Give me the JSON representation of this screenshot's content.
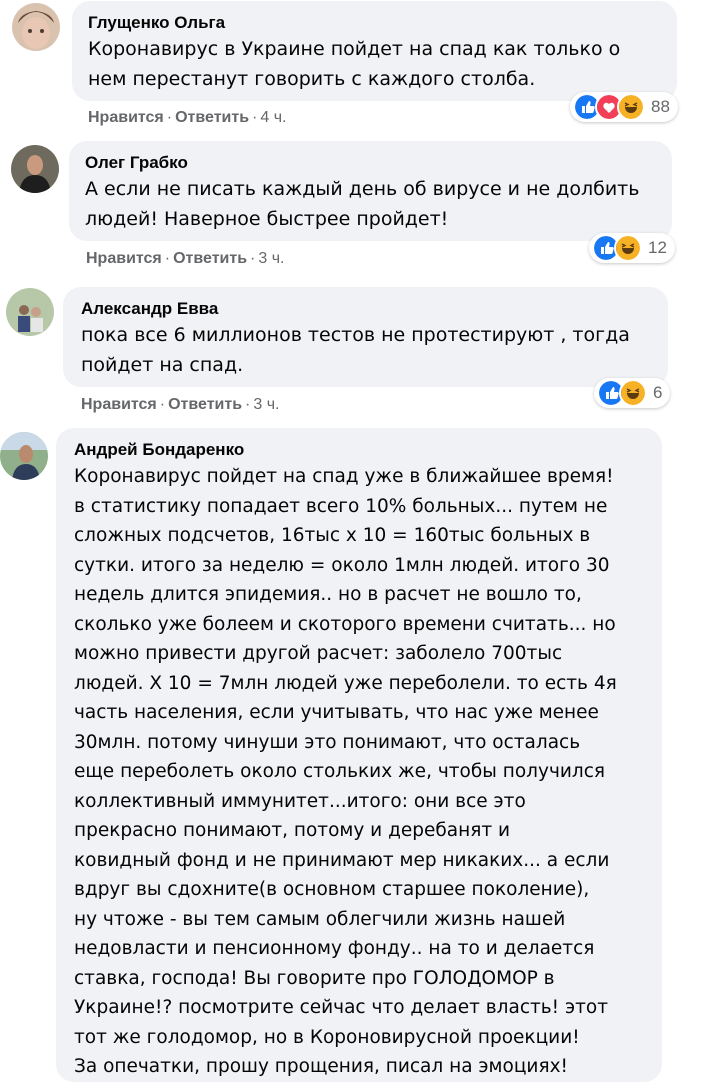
{
  "actions": {
    "like": "Нравится",
    "reply": "Ответить",
    "dot": "·"
  },
  "colors": {
    "bubble": "#f0f2f5",
    "meta": "#65676b",
    "like_blue": "#1877f2",
    "love_red": "#f33e58",
    "haha_yellow": "#f7b125"
  },
  "comments": [
    {
      "author": "Глущенко Ольга",
      "text": "Коронавирус в Украине пойдет на спад как только о\nнем перестанут говорить с каждого столба.",
      "time": "4 ч.",
      "reactions": [
        "like-icon",
        "love-icon",
        "haha-icon"
      ],
      "reaction_count": "88"
    },
    {
      "author": "Олег Грабко",
      "text": "А если не писать каждый день об вирусе и не долбить\nлюдей! Наверное быстрее пройдет!",
      "time": "3 ч.",
      "reactions": [
        "like-icon",
        "haha-icon"
      ],
      "reaction_count": "12"
    },
    {
      "author": "Александр Евва",
      "text": "пока все 6 миллионов тестов не протестируют , тогда\nпойдет на спад.",
      "time": "3 ч.",
      "reactions": [
        "like-icon",
        "haha-icon"
      ],
      "reaction_count": "6"
    },
    {
      "author": "Андрей Бондаренко",
      "text": "Коронавирус пойдет на спад уже в ближайшее время!\nв статистику попадает всего 10% больных... путем не\nсложных подсчетов, 16тыс х 10 = 160тыс больных в\nсутки. итого за неделю = около 1млн людей. итого 30\nнедель длится эпидемия.. но в расчет не вошло то,\nсколько уже болеем и скоторого времени считать... но\nможно привести другой расчет: заболело 700тыс\nлюдей. Х 10 = 7млн людей уже переболели. то есть 4я\nчасть населения, если учитывать, что нас уже менее\n30млн. потому чинуши это понимают, что осталась\nеще переболеть около стольких же, чтобы получился\nколлективный иммунитет...итого: они все это\nпрекрасно понимают, потому и деребанят и\nковидный фонд и не принимают мер никаких... а если\nвдруг вы сдохните(в основном старшее поколение),\nну чтоже - вы тем самым облегчили жизнь нашей\nнедовласти и пенсионному фонду.. на то и делается\nставка, господа! Вы говорите про ГОЛОДОМОР в\nУкраине!? посмотрите сейчас что делает власть! этот\nтот же голодомор, но в Короновирусной проекции!\nЗа опечатки, прошу прощения, писал на эмоциях!"
    }
  ]
}
